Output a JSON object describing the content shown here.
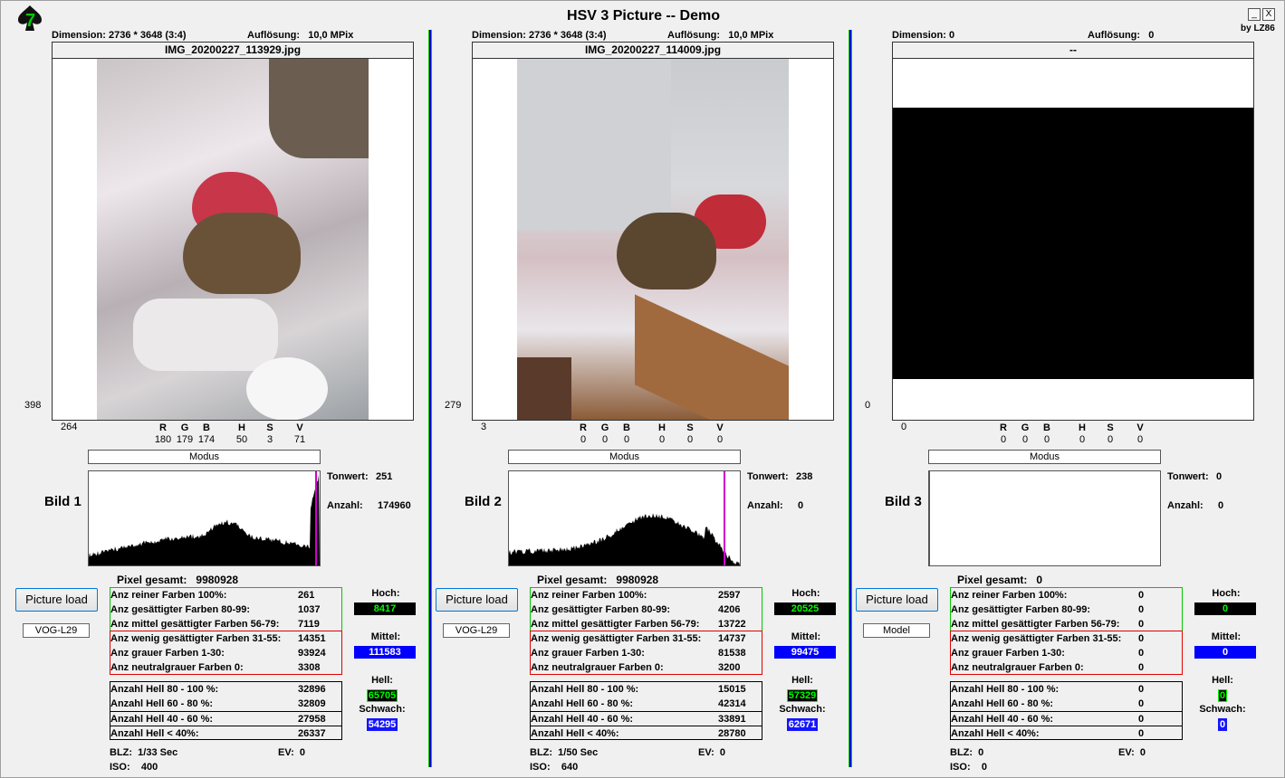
{
  "app": {
    "title": "HSV 3 Picture -- Demo",
    "by": "by LZ86",
    "minimize": "_",
    "close": "X"
  },
  "colors": {
    "separator": "#0000c8",
    "hist_marker": "#d000d0",
    "hoch_badge": "#000000",
    "mittel_badge": "#0000ff",
    "green_frame": "#00c800",
    "red_frame": "#e00000"
  },
  "labels": {
    "dimension": "Dimension:",
    "aufloesung": "Auflösung:",
    "modus": "Modus",
    "tonwert": "Tonwert:",
    "anzahl": "Anzahl:",
    "pixel_gesamt": "Pixel gesamt:",
    "picture_load": "Picture load",
    "hoch": "Hoch:",
    "mittel": "Mittel:",
    "hell": "Hell:",
    "schwach": "Schwach:",
    "blz": "BLZ:",
    "ev": "EV:",
    "iso": "ISO:",
    "r": "R",
    "g": "G",
    "b": "B",
    "h": "H",
    "s": "S",
    "v": "V",
    "rows": [
      "Anz reiner Farben 100%:",
      "Anz gesättigter Farben 80-99:",
      "Anz mittel gesättigter Farben 56-79:",
      "Anz wenig gesättigter Farben 31-55:",
      "Anz grauer Farben 1-30:",
      "Anz neutralgrauer Farben 0:",
      "Anzahl Hell 80 - 100 %:",
      "Anzahl Hell 60 - 80 %:",
      "Anzahl Hell 40 - 60 %:",
      "Anzahl Hell < 40%:"
    ]
  },
  "panels": [
    {
      "bild": "Bild 1",
      "dimension": "2736 * 3648 (3:4)",
      "aufloesung": "10,0 MPix",
      "filename": "IMG_20200227_113929.jpg",
      "y_coord": "398",
      "x_coord": "264",
      "rgb": [
        "180",
        "179",
        "174"
      ],
      "hsv": [
        "50",
        "3",
        "71"
      ],
      "tonwert": "251",
      "anzahl": "174960",
      "pixel_gesamt": "9980928",
      "camera": "VOG-L29",
      "values": [
        "261",
        "1037",
        "7119",
        "14351",
        "93924",
        "3308",
        "32896",
        "32809",
        "27958",
        "26337"
      ],
      "hoch": "8417",
      "mittel": "111583",
      "hell": "65705",
      "schwach": "54295",
      "blz": "1/33 Sec",
      "ev": "0",
      "iso": "400",
      "marker": 251
    },
    {
      "bild": "Bild 2",
      "dimension": "2736 * 3648 (3:4)",
      "aufloesung": "10,0 MPix",
      "filename": "IMG_20200227_114009.jpg",
      "y_coord": "279",
      "x_coord": "3",
      "rgb": [
        "0",
        "0",
        "0"
      ],
      "hsv": [
        "0",
        "0",
        "0"
      ],
      "tonwert": "238",
      "anzahl": "0",
      "pixel_gesamt": "9980928",
      "camera": "VOG-L29",
      "values": [
        "2597",
        "4206",
        "13722",
        "14737",
        "81538",
        "3200",
        "15015",
        "42314",
        "33891",
        "28780"
      ],
      "hoch": "20525",
      "mittel": "99475",
      "hell": "57329",
      "schwach": "62671",
      "blz": "1/50 Sec",
      "ev": "0",
      "iso": "640",
      "marker": 238
    },
    {
      "bild": "Bild 3",
      "dimension": "0",
      "aufloesung": "0",
      "filename": "--",
      "y_coord": "0",
      "x_coord": "0",
      "rgb": [
        "0",
        "0",
        "0"
      ],
      "hsv": [
        "0",
        "0",
        "0"
      ],
      "tonwert": "0",
      "anzahl": "0",
      "pixel_gesamt": "0",
      "camera": "Model",
      "values": [
        "0",
        "0",
        "0",
        "0",
        "0",
        "0",
        "0",
        "0",
        "0",
        "0"
      ],
      "hoch": "0",
      "mittel": "0",
      "hell": "0",
      "schwach": "0",
      "blz": "0",
      "ev": "0",
      "iso": "0",
      "marker": 0
    }
  ]
}
